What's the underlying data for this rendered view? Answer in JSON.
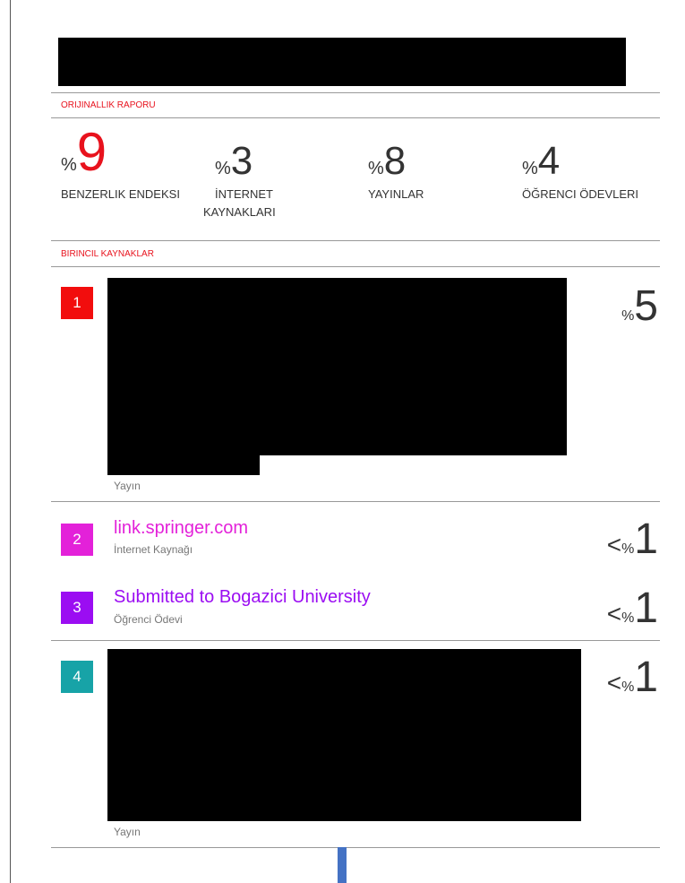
{
  "report": {
    "section_title": "ORIJINALLIK RAPORU",
    "stats": [
      {
        "percent": "%",
        "value": "9",
        "label": "BENZERLIK ENDEKSI",
        "label2": ""
      },
      {
        "percent": "%",
        "value": "3",
        "label": "İNTERNET",
        "label2": "KAYNAKLARI"
      },
      {
        "percent": "%",
        "value": "8",
        "label": "YAYINLAR",
        "label2": ""
      },
      {
        "percent": "%",
        "value": "4",
        "label": "ÖĞRENCI ÖDEVLERI",
        "label2": ""
      }
    ]
  },
  "sources": {
    "section_title": "BIRINCIL KAYNAKLAR",
    "items": [
      {
        "index": "1",
        "title": "",
        "type": "Yayın",
        "prefix": "",
        "percent": "%",
        "value": "5",
        "badge_color": "#f20d0d"
      },
      {
        "index": "2",
        "title": "link.springer.com",
        "type": "İnternet Kaynağı",
        "prefix": "<",
        "percent": "%",
        "value": "1",
        "badge_color": "#e321d9",
        "title_color": "#e321d9"
      },
      {
        "index": "3",
        "title": "Submitted to Bogazici University",
        "type": "Öğrenci Ödevi",
        "prefix": "<",
        "percent": "%",
        "value": "1",
        "badge_color": "#9b0df2",
        "title_color": "#9b0df2"
      },
      {
        "index": "4",
        "title": "",
        "type": "Yayın",
        "prefix": "<",
        "percent": "%",
        "value": "1",
        "badge_color": "#17a3a7"
      }
    ]
  }
}
